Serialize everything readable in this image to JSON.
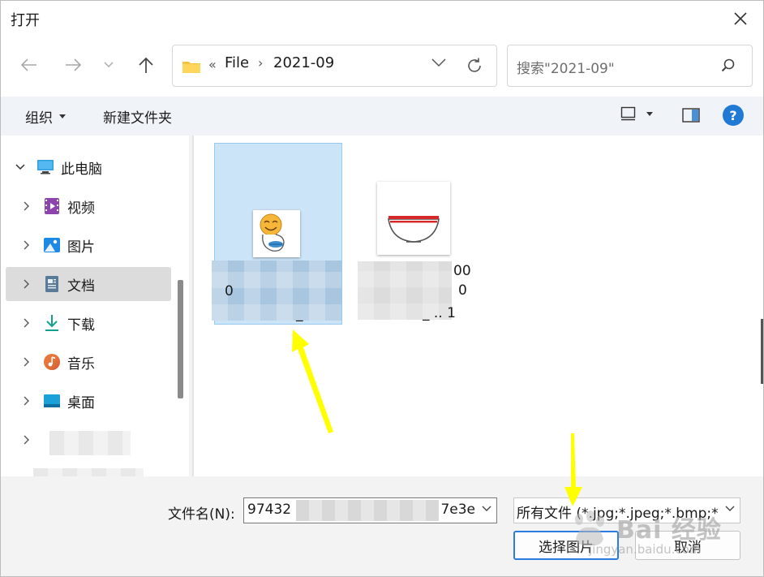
{
  "window": {
    "title": "打开",
    "close_icon": "close-icon"
  },
  "nav": {
    "back_icon": "arrow-left-icon",
    "forward_icon": "arrow-right-icon",
    "recent_icon": "chevron-down-icon",
    "up_icon": "arrow-up-icon",
    "address": {
      "overflow_glyph": "«",
      "segments": [
        "File",
        "2021-09"
      ],
      "separator": "›"
    },
    "search_placeholder": "搜索\"2021-09\""
  },
  "commandbar": {
    "organize_label": "组织",
    "new_folder_label": "新建文件夹"
  },
  "sidebar": {
    "items": [
      {
        "label": "此电脑",
        "icon": "monitor-icon"
      },
      {
        "label": "视频",
        "icon": "video-icon"
      },
      {
        "label": "图片",
        "icon": "picture-icon"
      },
      {
        "label": "文档",
        "icon": "document-icon"
      },
      {
        "label": "下载",
        "icon": "download-icon"
      },
      {
        "label": "音乐",
        "icon": "music-icon"
      },
      {
        "label": "桌面",
        "icon": "desktop-icon"
      }
    ]
  },
  "files": [
    {
      "line1": "0",
      "line2": "_",
      "thumb_icon": "smiley-sticker-icon"
    },
    {
      "line1": "00",
      "line2": "0",
      "line3": "_ .. 1",
      "thumb_icon": "bowl-icon"
    }
  ],
  "footer": {
    "filename_label": "文件名(N):",
    "filename_start": "97432",
    "filename_end": "7e3e",
    "filetype_value": "所有文件 (*.jpg;*.jpeg;*.bmp;*",
    "open_button": "选择图片",
    "cancel_button": "取消"
  },
  "watermark": {
    "text": "Bai 经验",
    "sub": "jingyan.baidu.com"
  },
  "colors": {
    "accent": "#1f7ad6",
    "selection": "#cce4f7",
    "annotation_arrow": "#ffff00"
  }
}
